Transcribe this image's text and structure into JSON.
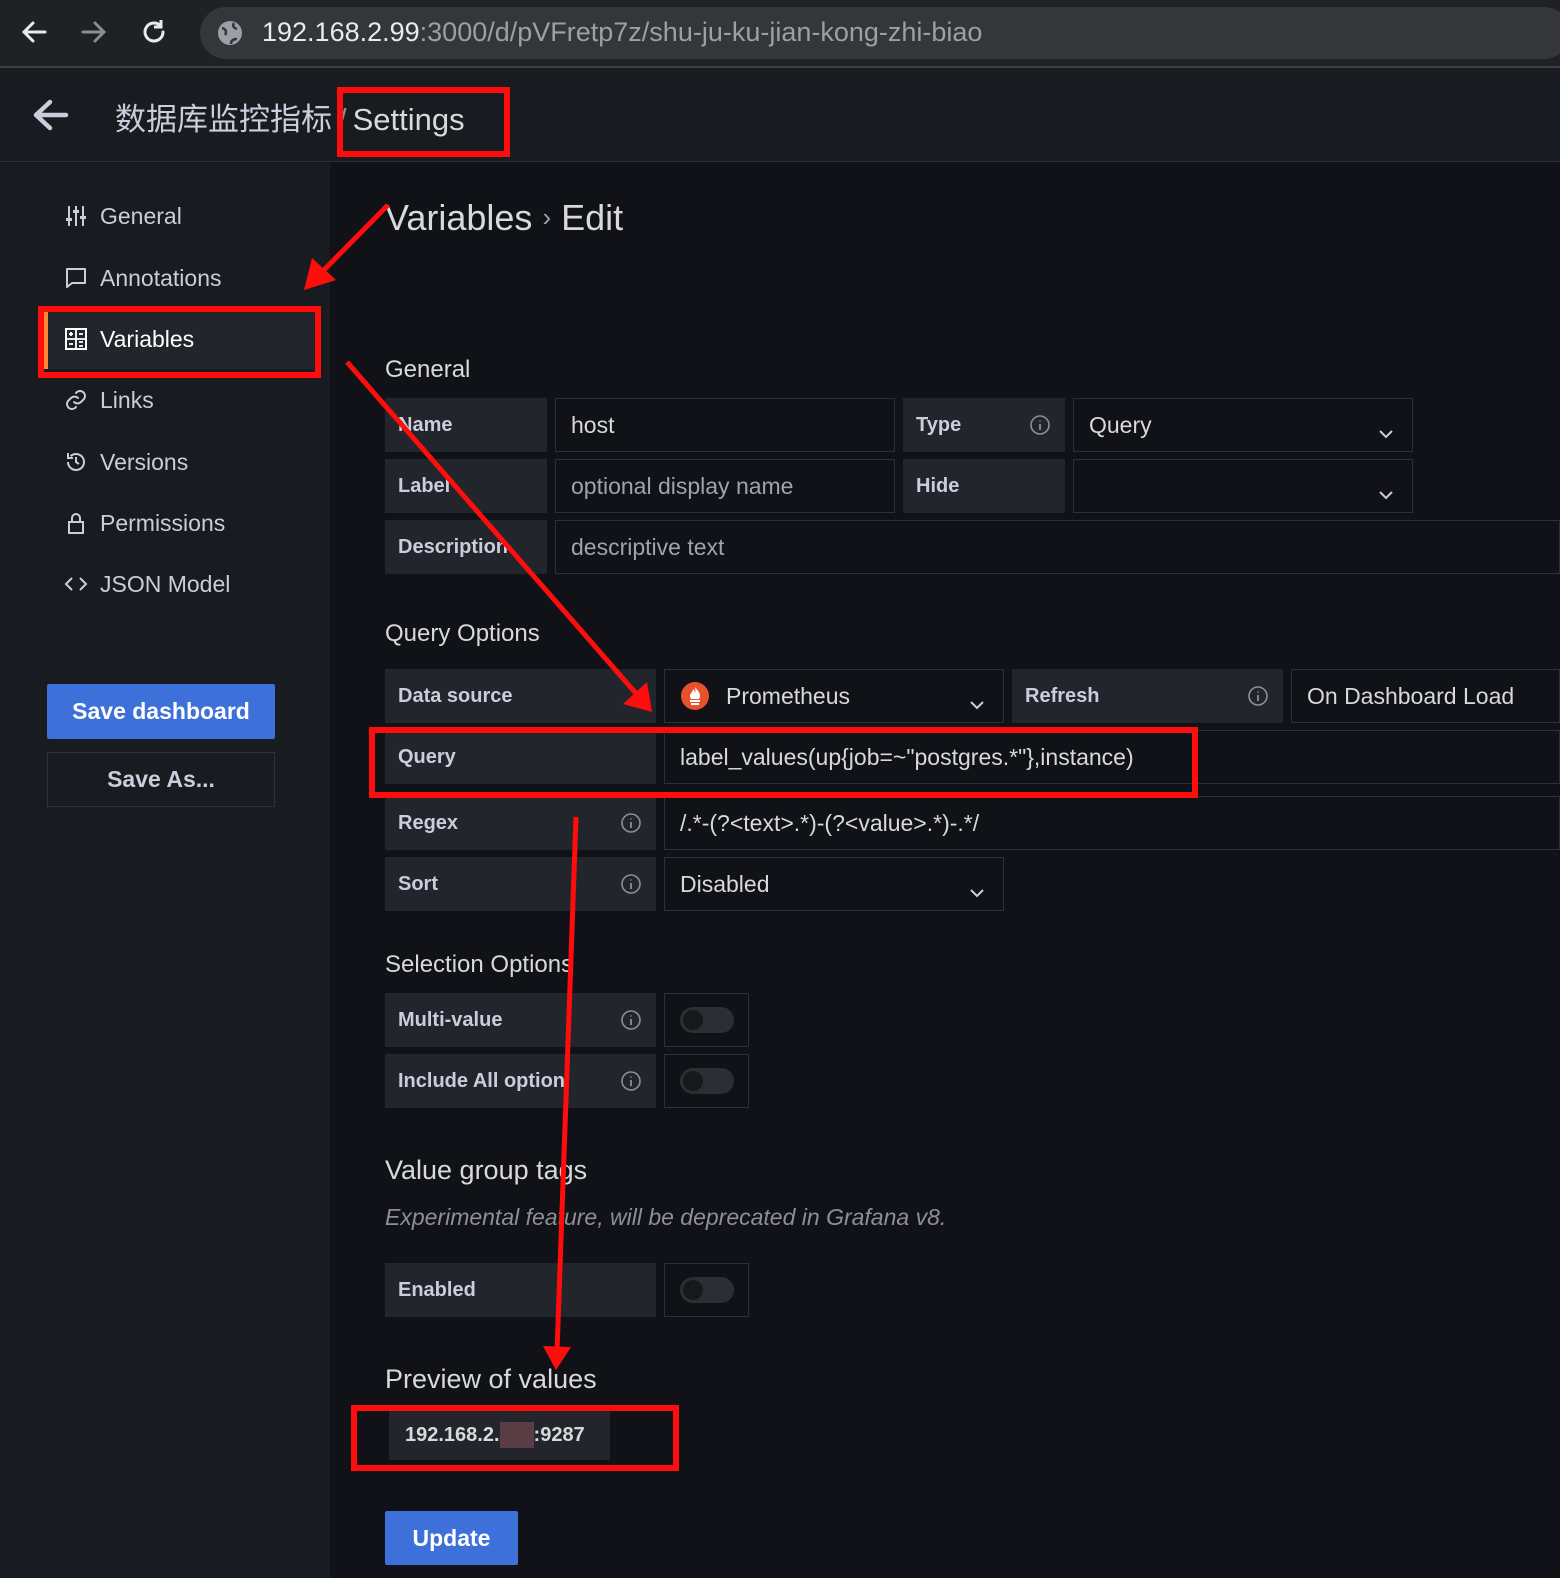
{
  "browser": {
    "url_host": "192.168.2.99",
    "url_path": ":3000/d/pVFretp7z/shu-ju-ku-jian-kong-zhi-biao"
  },
  "topnav": {
    "dashboard_title": "数据库监控指标",
    "separator": "/",
    "page": "Settings"
  },
  "sidebar": {
    "items": [
      {
        "label": "General",
        "icon": "sliders-icon"
      },
      {
        "label": "Annotations",
        "icon": "comment-icon"
      },
      {
        "label": "Variables",
        "icon": "calculator-icon"
      },
      {
        "label": "Links",
        "icon": "link-icon"
      },
      {
        "label": "Versions",
        "icon": "history-icon"
      },
      {
        "label": "Permissions",
        "icon": "lock-icon"
      },
      {
        "label": "JSON Model",
        "icon": "code-icon"
      }
    ],
    "save_dashboard": "Save dashboard",
    "save_as": "Save As..."
  },
  "main": {
    "title_part1": "Variables",
    "title_sep": "›",
    "title_part2": "Edit",
    "general": {
      "heading": "General",
      "name_label": "Name",
      "name_value": "host",
      "type_label": "Type",
      "type_value": "Query",
      "label_label": "Label",
      "label_placeholder": "optional display name",
      "hide_label": "Hide",
      "hide_value": "",
      "description_label": "Description",
      "description_placeholder": "descriptive text"
    },
    "query_options": {
      "heading": "Query Options",
      "datasource_label": "Data source",
      "datasource_value": "Prometheus",
      "refresh_label": "Refresh",
      "refresh_value": "On Dashboard Load",
      "query_label": "Query",
      "query_value": "label_values(up{job=~\"postgres.*\"},instance)",
      "regex_label": "Regex",
      "regex_value": "/.*-(?<text>.*)-(?<value>.*)-.*/",
      "sort_label": "Sort",
      "sort_value": "Disabled"
    },
    "selection_options": {
      "heading": "Selection Options",
      "multi_value_label": "Multi-value",
      "include_all_label": "Include All option"
    },
    "value_group_tags": {
      "heading": "Value group tags",
      "note": "Experimental feature, will be deprecated in Grafana v8.",
      "enabled_label": "Enabled"
    },
    "preview": {
      "heading": "Preview of values",
      "value_prefix": "192.168.2.",
      "value_suffix": ":9287"
    },
    "update_button": "Update"
  },
  "colors": {
    "annotation_red": "#ff0d0d",
    "primary_blue": "#3d71d9",
    "active_accent": "#ff8833"
  }
}
